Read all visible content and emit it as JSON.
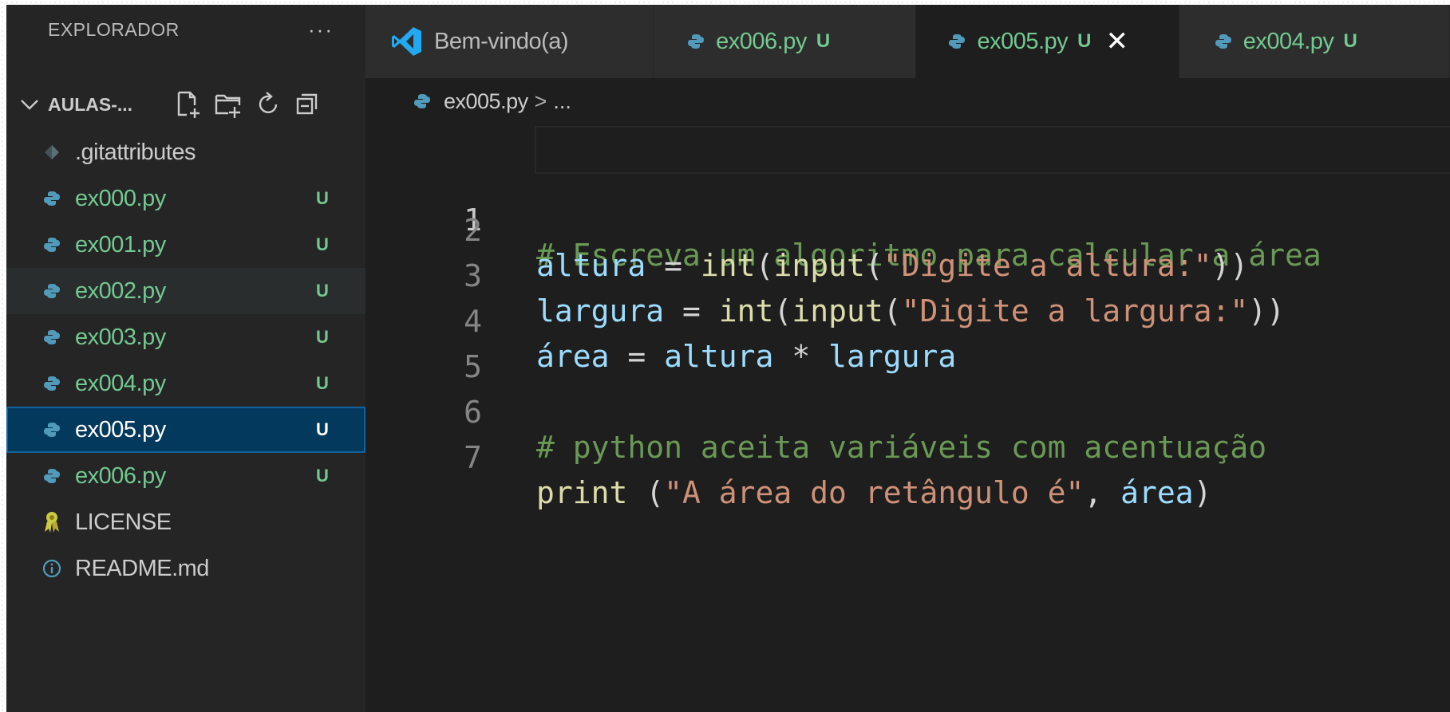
{
  "sidebar": {
    "title": "EXPLORADOR",
    "more_label": "···",
    "folder_name": "AULAS-...",
    "files": [
      {
        "name": ".gitattributes",
        "badge": "",
        "icon": "git-icon"
      },
      {
        "name": "ex000.py",
        "badge": "U",
        "icon": "python-icon"
      },
      {
        "name": "ex001.py",
        "badge": "U",
        "icon": "python-icon"
      },
      {
        "name": "ex002.py",
        "badge": "U",
        "icon": "python-icon"
      },
      {
        "name": "ex003.py",
        "badge": "U",
        "icon": "python-icon"
      },
      {
        "name": "ex004.py",
        "badge": "U",
        "icon": "python-icon"
      },
      {
        "name": "ex005.py",
        "badge": "U",
        "icon": "python-icon"
      },
      {
        "name": "ex006.py",
        "badge": "U",
        "icon": "python-icon"
      },
      {
        "name": "LICENSE",
        "badge": "",
        "icon": "license-icon"
      },
      {
        "name": "README.md",
        "badge": "",
        "icon": "info-icon"
      }
    ]
  },
  "tabs": [
    {
      "label": "Bem-vindo(a)",
      "badge": "",
      "icon": "vscode-icon"
    },
    {
      "label": "ex006.py",
      "badge": "U",
      "icon": "python-icon"
    },
    {
      "label": "ex005.py",
      "badge": "U",
      "icon": "python-icon",
      "close": "✕"
    },
    {
      "label": "ex004.py",
      "badge": "U",
      "icon": "python-icon"
    }
  ],
  "breadcrumb": {
    "file": "ex005.py",
    "separator": ">",
    "rest": "..."
  },
  "editor": {
    "line_numbers": [
      "1",
      "2",
      "3",
      "4",
      "5",
      "6",
      "7"
    ],
    "line1": {
      "comment": "# Escreva um algoritmo para calcular a área"
    },
    "line2": {
      "var": "altura",
      "op": " = ",
      "fn1": "int",
      "p1": "(",
      "fn2": "input",
      "p2": "(",
      "str": "\"Digite a altura:\"",
      "p3": "))"
    },
    "line3": {
      "var": "largura",
      "op": " = ",
      "fn1": "int",
      "p1": "(",
      "fn2": "input",
      "p2": "(",
      "str": "\"Digite a largura:\"",
      "p3": "))"
    },
    "line4": {
      "var": "área",
      "op": " = ",
      "v2": "altura",
      "op2": " * ",
      "v3": "largura"
    },
    "line6": {
      "comment": "# python aceita variáveis com acentuação"
    },
    "line7": {
      "fn": "print",
      "p1": " (",
      "str": "\"A área do retângulo é\"",
      "comma": ", ",
      "var": "área",
      "p2": ")"
    }
  },
  "colors": {
    "accent_untracked": "#73c991",
    "selection": "#04395e",
    "python_icon": "#519aba",
    "vscode_blue": "#23a9f2",
    "license_icon": "#cbcb41"
  }
}
